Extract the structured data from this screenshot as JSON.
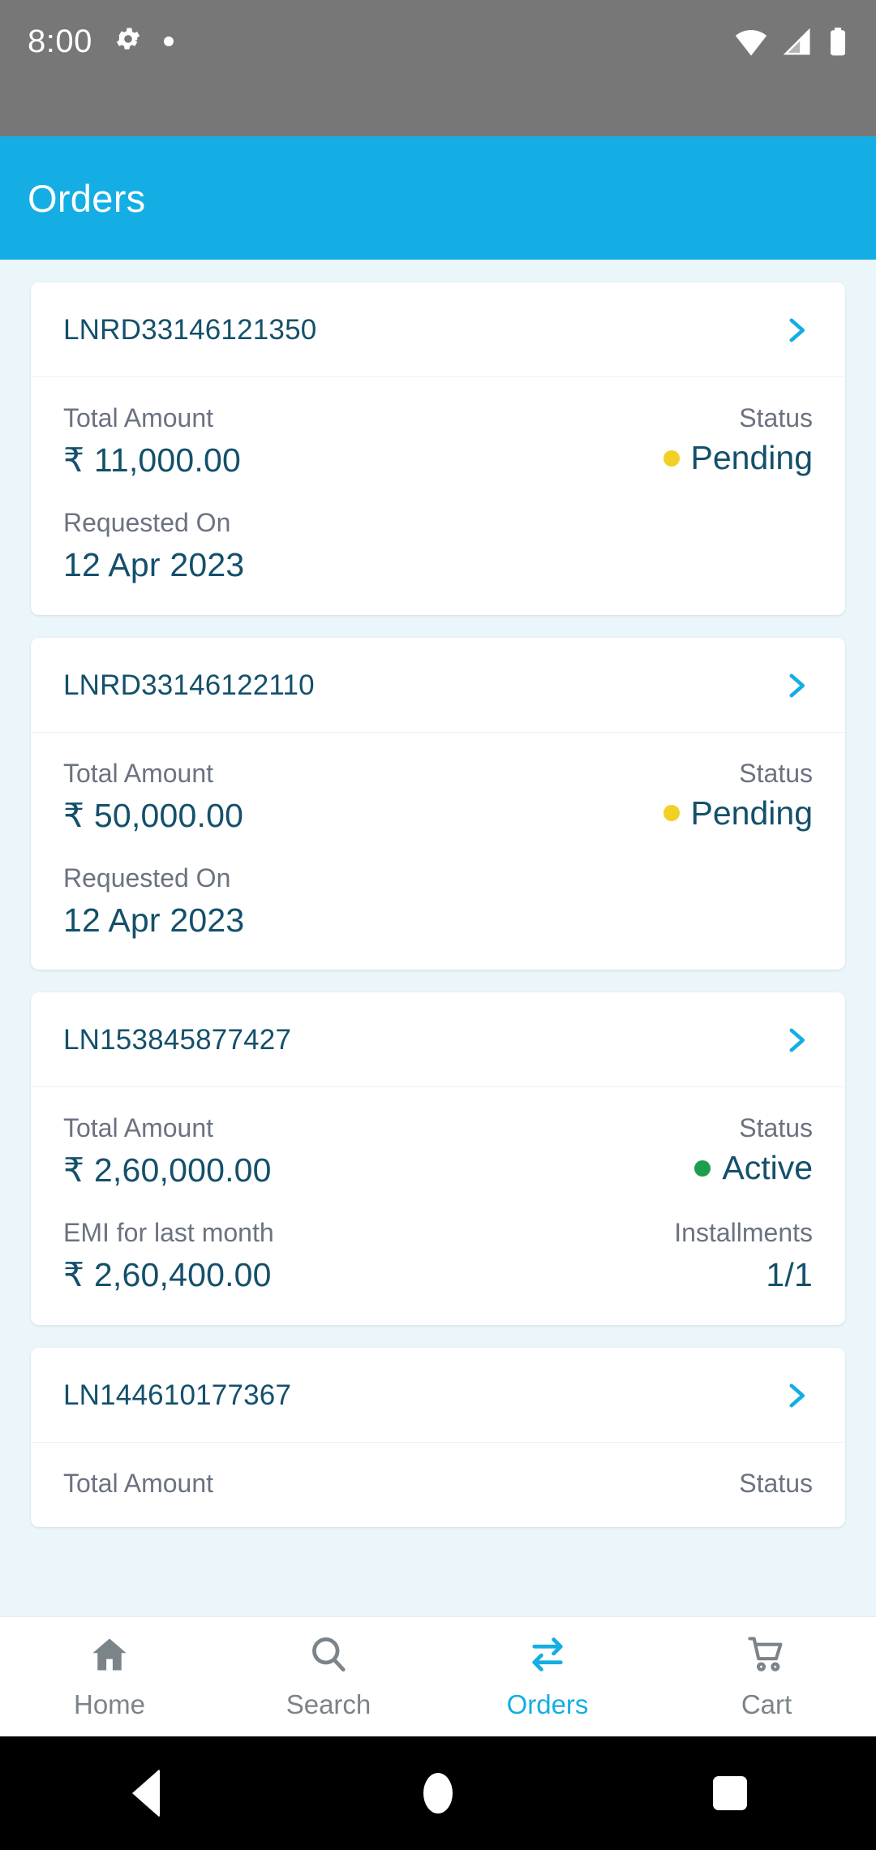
{
  "status_bar": {
    "time": "8:00",
    "icons": [
      "gear-icon",
      "dot-indicator",
      "wifi-icon",
      "signal-icon",
      "battery-icon"
    ]
  },
  "app_bar": {
    "title": "Orders"
  },
  "colors": {
    "primary": "#14AEE4",
    "text_dark": "#14506b",
    "label_gray": "#6b7280",
    "pending": "#F2D024",
    "active": "#1C9E4D",
    "background": "#eaf6fa"
  },
  "orders": [
    {
      "id": "LNRD33146121350",
      "fields": [
        {
          "label": "Total Amount",
          "value": "₹ 11,000.00"
        },
        {
          "label": "Status",
          "value": "Pending",
          "dot": "#F2D024"
        },
        {
          "label": "Requested On",
          "value": "12 Apr 2023"
        }
      ]
    },
    {
      "id": "LNRD33146122110",
      "fields": [
        {
          "label": "Total Amount",
          "value": "₹ 50,000.00"
        },
        {
          "label": "Status",
          "value": "Pending",
          "dot": "#F2D024"
        },
        {
          "label": "Requested On",
          "value": "12 Apr 2023"
        }
      ]
    },
    {
      "id": "LN153845877427",
      "fields": [
        {
          "label": "Total Amount",
          "value": "₹ 2,60,000.00"
        },
        {
          "label": "Status",
          "value": "Active",
          "dot": "#1C9E4D"
        },
        {
          "label": "EMI for last month",
          "value": "₹ 2,60,400.00"
        },
        {
          "label": "Installments",
          "value": "1/1"
        }
      ]
    },
    {
      "id": "LN144610177367",
      "fields": []
    }
  ],
  "card1": {
    "id": "LNRD33146121350",
    "total_label": "Total Amount",
    "total_value": "₹ 11,000.00",
    "status_label": "Status",
    "status_value": "Pending",
    "requested_label": "Requested On",
    "requested_value": "12 Apr 2023"
  },
  "card2": {
    "id": "LNRD33146122110",
    "total_label": "Total Amount",
    "total_value": "₹ 50,000.00",
    "status_label": "Status",
    "status_value": "Pending",
    "requested_label": "Requested On",
    "requested_value": "12 Apr 2023"
  },
  "card3": {
    "id": "LN153845877427",
    "total_label": "Total Amount",
    "total_value": "₹ 2,60,000.00",
    "status_label": "Status",
    "status_value": "Active",
    "emi_label": "EMI for last month",
    "emi_value": "₹ 2,60,400.00",
    "installments_label": "Installments",
    "installments_value": "1/1"
  },
  "card4": {
    "id": "LN144610177367"
  },
  "bottom_nav": {
    "items": [
      {
        "label": "Home",
        "icon": "home-icon",
        "active": false
      },
      {
        "label": "Search",
        "icon": "search-icon",
        "active": false
      },
      {
        "label": "Orders",
        "icon": "swap-arrows-icon",
        "active": true
      },
      {
        "label": "Cart",
        "icon": "cart-icon",
        "active": false
      }
    ]
  },
  "android_nav": {
    "back": "back-triangle-icon",
    "home": "home-circle-icon",
    "recents": "recents-square-icon"
  }
}
